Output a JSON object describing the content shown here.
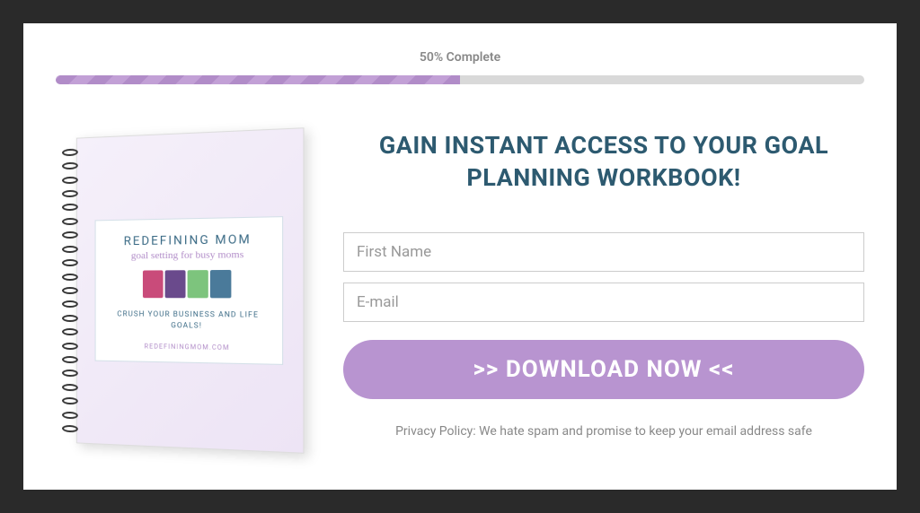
{
  "progress": {
    "label": "50% Complete",
    "percent": 50
  },
  "book": {
    "title": "REDEFINING MOM",
    "subtitle": "goal setting for busy moms",
    "tagline": "CRUSH YOUR BUSINESS AND LIFE GOALS!",
    "url": "REDEFININGMOM.COM"
  },
  "form": {
    "headline": "GAIN INSTANT ACCESS TO YOUR GOAL PLANNING WORKBOOK!",
    "firstname_placeholder": "First Name",
    "email_placeholder": "E-mail",
    "button_label": ">> DOWNLOAD NOW <<",
    "privacy": "Privacy Policy: We hate spam and promise to keep your email address safe"
  },
  "colors": {
    "accent": "#b894d0",
    "heading": "#2d5a70"
  }
}
